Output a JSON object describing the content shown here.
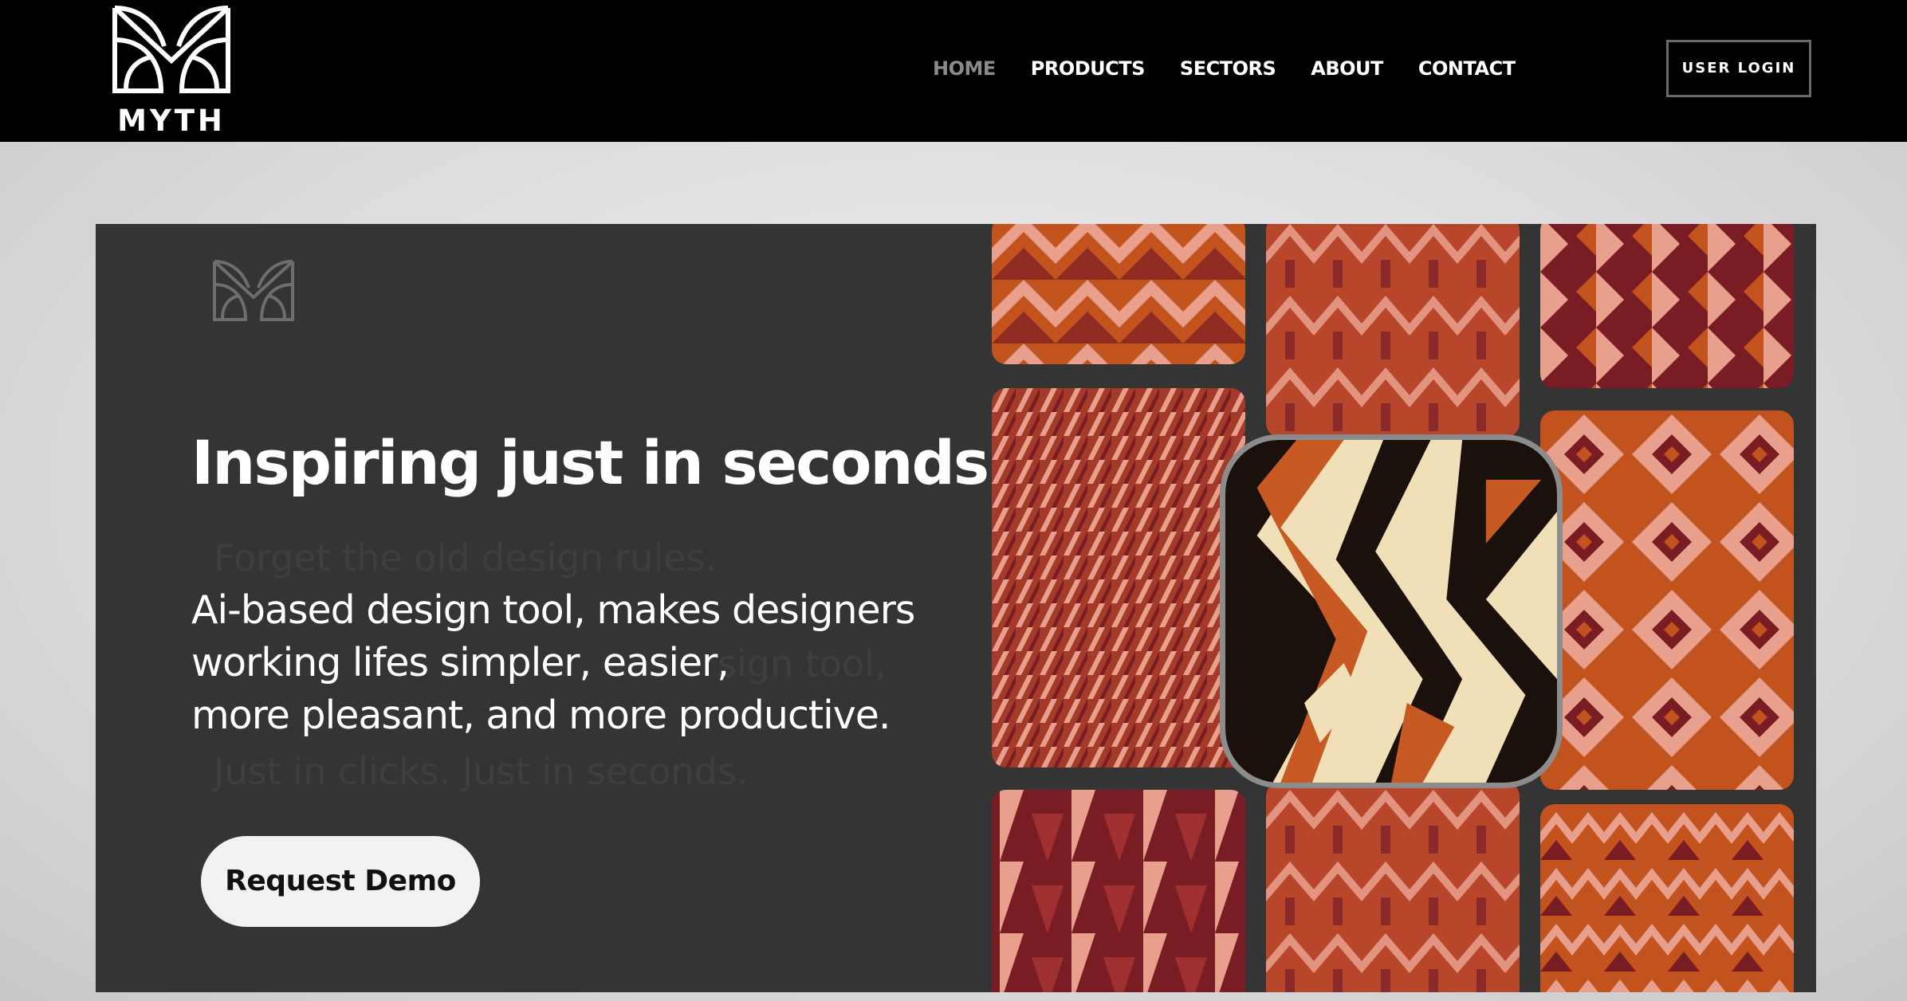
{
  "brand": {
    "name": "MYTH"
  },
  "nav": {
    "items": [
      {
        "label": "HOME",
        "active": true
      },
      {
        "label": "PRODUCTS",
        "active": false
      },
      {
        "label": "SECTORS",
        "active": false
      },
      {
        "label": "ABOUT",
        "active": false
      },
      {
        "label": "CONTACT",
        "active": false
      }
    ],
    "login_label": "USER LOGIN"
  },
  "hero": {
    "headline": "Inspiring just in seconds",
    "subtext_lines": [
      "Ai-based design tool, makes designers",
      "working lifes simpler, easier,",
      "more pleasant, and more productive."
    ],
    "ghost_lines": [
      "Forget the old design rules.",
      "Just in clicks. Just in seconds.",
      "sign tool,"
    ],
    "cta_label": "Request Demo"
  },
  "colors": {
    "nav_bg": "#000000",
    "nav_active": "#8a8a8a",
    "hero_bg": "#343434",
    "pattern_dark": "#7a1c24",
    "pattern_orange": "#c2521e",
    "pattern_pink": "#e8a08c",
    "featured_black": "#1b110c",
    "featured_cream": "#f1dfb8"
  },
  "icons": {
    "logo": "myth-logo-icon",
    "hero_mark": "myth-mark-icon"
  }
}
